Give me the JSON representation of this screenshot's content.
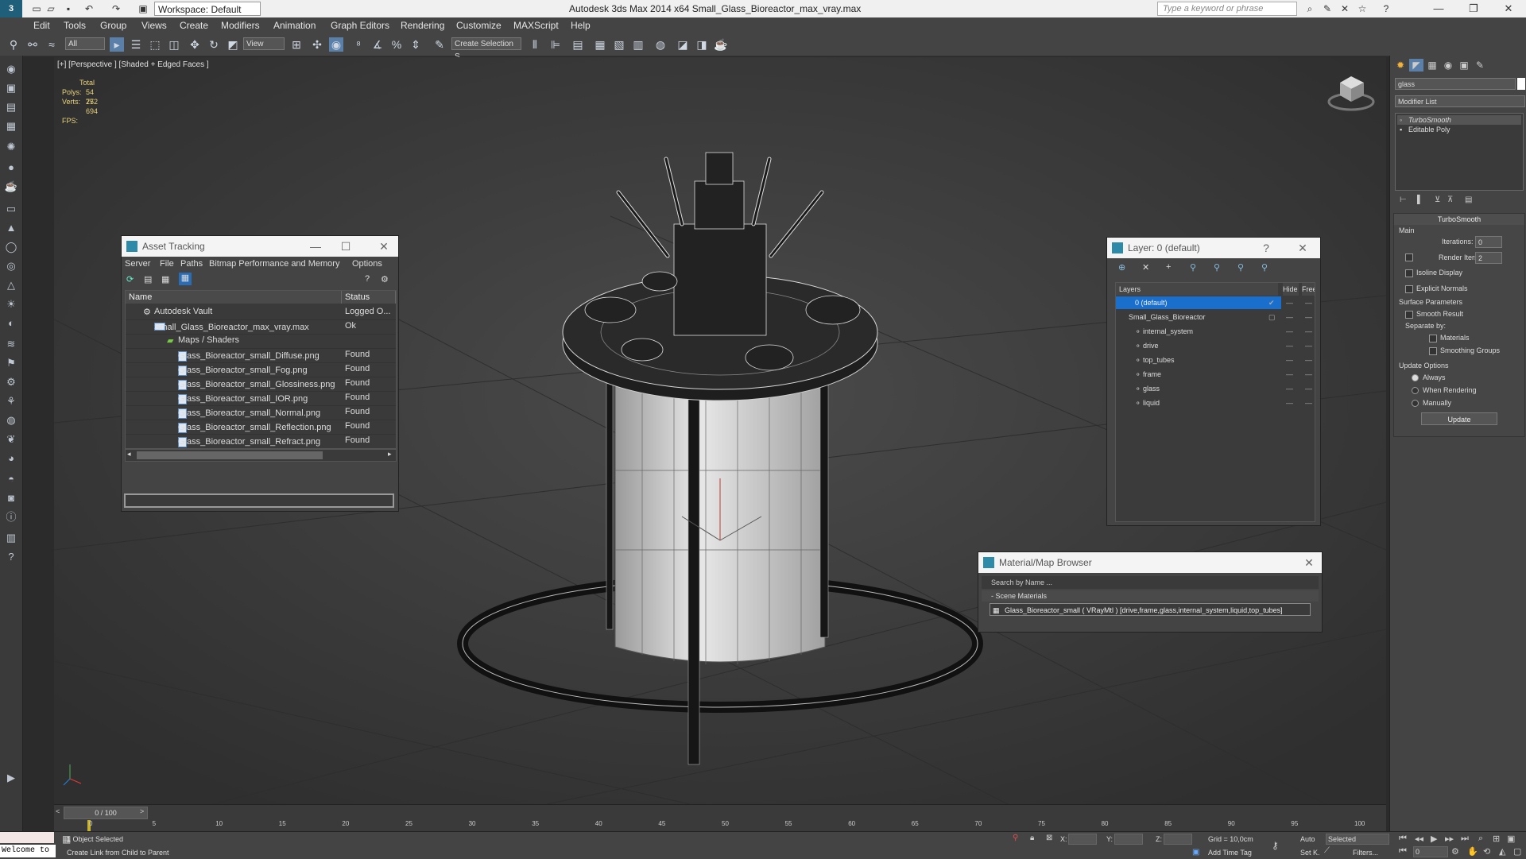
{
  "window": {
    "app_title": "Autodesk 3ds Max  2014 x64     Small_Glass_Bioreactor_max_vray.max",
    "workspace": "Workspace: Default",
    "search_placeholder": "Type a keyword or phrase"
  },
  "menu": [
    "Edit",
    "Tools",
    "Group",
    "Views",
    "Create",
    "Modifiers",
    "Animation",
    "Graph Editors",
    "Rendering",
    "Customize",
    "MAXScript",
    "Help"
  ],
  "toolbar": {
    "selection_filter": "All",
    "ref_coord": "View",
    "named_selection": "Create Selection S"
  },
  "viewport": {
    "label": "[+] [Perspective ] [Shaded + Edged Faces ]",
    "stats_total": "Total",
    "polys_label": "Polys:",
    "polys_value": "54 752",
    "verts_label": "Verts:",
    "verts_value": "27 694",
    "fps_label": "FPS:"
  },
  "asset_tracking": {
    "title": "Asset Tracking",
    "menu": [
      "Server",
      "File",
      "Paths",
      "Bitmap Performance and Memory",
      "Options"
    ],
    "col_name": "Name",
    "col_status": "Status",
    "rows": [
      {
        "name": "Autodesk Vault",
        "status": "Logged O..."
      },
      {
        "name": "Small_Glass_Bioreactor_max_vray.max",
        "status": "Ok"
      },
      {
        "name": "Maps / Shaders",
        "status": ""
      },
      {
        "name": "Glass_Bioreactor_small_Diffuse.png",
        "status": "Found"
      },
      {
        "name": "Glass_Bioreactor_small_Fog.png",
        "status": "Found"
      },
      {
        "name": "Glass_Bioreactor_small_Glossiness.png",
        "status": "Found"
      },
      {
        "name": "Glass_Bioreactor_small_IOR.png",
        "status": "Found"
      },
      {
        "name": "Glass_Bioreactor_small_Normal.png",
        "status": "Found"
      },
      {
        "name": "Glass_Bioreactor_small_Reflection.png",
        "status": "Found"
      },
      {
        "name": "Glass_Bioreactor_small_Refract.png",
        "status": "Found"
      }
    ]
  },
  "layer_dialog": {
    "title": "Layer: 0 (default)",
    "help": "?",
    "col_layers": "Layers",
    "col_hide": "Hide",
    "col_freeze": "Freez",
    "rows": [
      {
        "name": "0 (default)"
      },
      {
        "name": "Small_Glass_Bioreactor"
      },
      {
        "name": "internal_system"
      },
      {
        "name": "drive"
      },
      {
        "name": "top_tubes"
      },
      {
        "name": "frame"
      },
      {
        "name": "glass"
      },
      {
        "name": "liquid"
      }
    ]
  },
  "material_browser": {
    "title": "Material/Map Browser",
    "search": "Search by Name ...",
    "group": "- Scene Materials",
    "item": "Glass_Bioreactor_small  ( VRayMtl ) [drive,frame,glass,internal_system,liquid,top_tubes]"
  },
  "command_panel": {
    "object_name": "glass",
    "modifier_list": "Modifier List",
    "stack": [
      "TurboSmooth",
      "Editable Poly"
    ],
    "turbosmooth": {
      "title": "TurboSmooth",
      "main": "Main",
      "iterations_label": "Iterations:",
      "iterations": "0",
      "render_iters_label": "Render Iters:",
      "render_iters": "2",
      "isoline": "Isoline Display",
      "explicit": "Explicit Normals",
      "surface": "Surface Parameters",
      "smooth_result": "Smooth Result",
      "separate_by": "Separate by:",
      "materials": "Materials",
      "smoothing_groups": "Smoothing Groups",
      "update_options": "Update Options",
      "always": "Always",
      "when_rendering": "When Rendering",
      "manually": "Manually",
      "update_btn": "Update"
    }
  },
  "timeline": {
    "frame": "0 / 100",
    "ticks": [
      "0",
      "5",
      "10",
      "15",
      "20",
      "25",
      "30",
      "35",
      "40",
      "45",
      "50",
      "55",
      "60",
      "65",
      "70",
      "75",
      "80",
      "85",
      "90",
      "95",
      "100"
    ]
  },
  "status": {
    "welcome": "Welcome to",
    "selected": "1 Object Selected",
    "prompt": "Create Link from Child to Parent",
    "x": "X:",
    "y": "Y:",
    "z": "Z:",
    "grid": "Grid = 10,0cm",
    "add_time_tag": "Add Time Tag",
    "auto": "Auto",
    "set_key": "Set K.",
    "selected_mode": "Selected",
    "filters": "Filters...",
    "frame_field": "0"
  }
}
